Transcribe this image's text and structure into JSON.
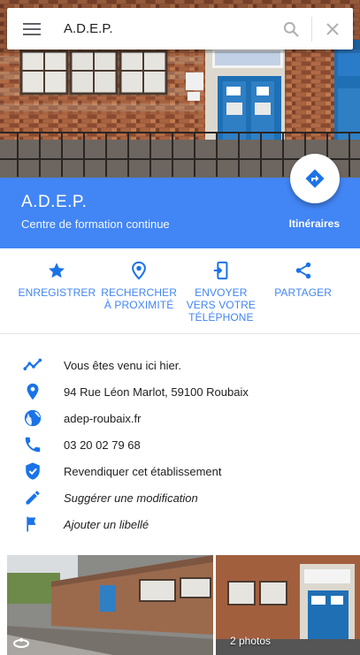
{
  "search": {
    "query": "A.D.E.P."
  },
  "place": {
    "name": "A.D.E.P.",
    "category": "Centre de formation continue",
    "directions_label": "Itinéraires"
  },
  "actions": [
    {
      "label": "ENREGISTRER",
      "icon": "star-icon"
    },
    {
      "label": "RECHERCHER À PROXIMITÉ",
      "icon": "nearby-icon"
    },
    {
      "label": "ENVOYER VERS VOTRE TÉLÉPHONE",
      "icon": "send-to-phone-icon"
    },
    {
      "label": "PARTAGER",
      "icon": "share-icon"
    }
  ],
  "info": [
    {
      "text": "Vous êtes venu ici hier.",
      "icon": "timeline-icon"
    },
    {
      "text": "94 Rue Léon Marlot, 59100 Roubaix",
      "icon": "location-pin-icon"
    },
    {
      "text": "adep-roubaix.fr",
      "icon": "globe-icon"
    },
    {
      "text": "03 20 02 79 68",
      "icon": "phone-icon"
    },
    {
      "text": "Revendiquer cet établissement",
      "icon": "verified-shield-icon"
    },
    {
      "text": "Suggérer une modification",
      "icon": "edit-pencil-icon"
    },
    {
      "text": "Ajouter un libellé",
      "icon": "flag-icon"
    }
  ],
  "photos": {
    "count_label": "2 photos"
  },
  "colors": {
    "accent": "#4285f4",
    "icon": "#1a73e8"
  }
}
